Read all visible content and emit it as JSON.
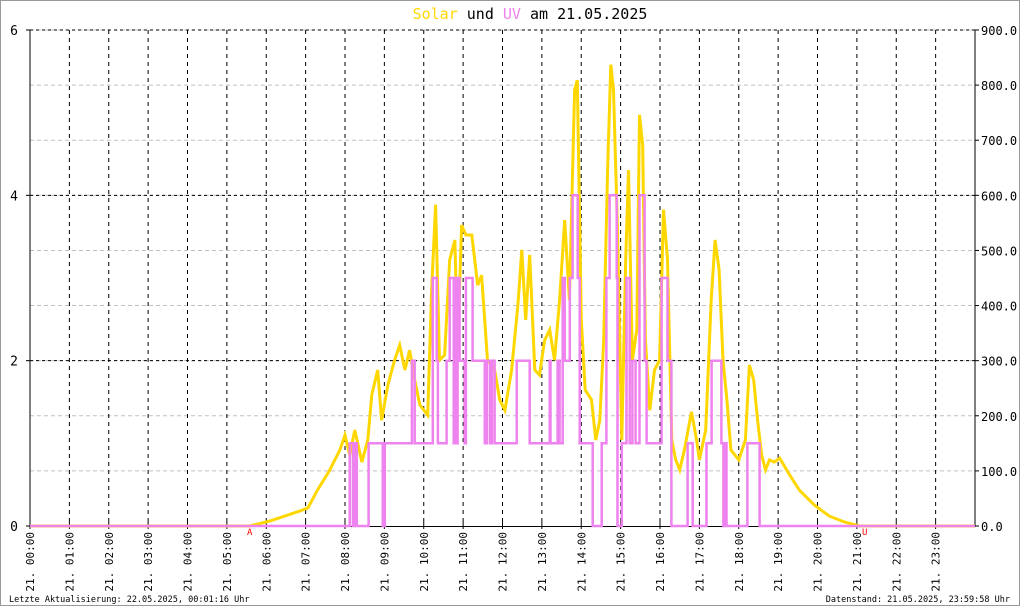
{
  "chart_data": {
    "type": "line",
    "title_parts": [
      {
        "text": "Solar",
        "color": "#ffd700"
      },
      {
        "text": " und ",
        "color": "#000000"
      },
      {
        "text": "UV",
        "color": "#ee82ee"
      },
      {
        "text": " am 21.05.2025",
        "color": "#000000"
      }
    ],
    "x_range_hours": [
      0,
      24
    ],
    "x_tick_labels": [
      "21. 00:00",
      "21. 01:00",
      "21. 02:00",
      "21. 03:00",
      "21. 04:00",
      "21. 05:00",
      "21. 06:00",
      "21. 07:00",
      "21. 08:00",
      "21. 09:00",
      "21. 10:00",
      "21. 11:00",
      "21. 12:00",
      "21. 13:00",
      "21. 14:00",
      "21. 15:00",
      "21. 16:00",
      "21. 17:00",
      "21. 18:00",
      "21. 19:00",
      "21. 20:00",
      "21. 21:00",
      "21. 22:00",
      "21. 23:00"
    ],
    "left_axis": {
      "label": "UV",
      "ylim": [
        0,
        6
      ],
      "ticks": [
        "0",
        "2",
        "4",
        "6"
      ],
      "tick_values": [
        0,
        2,
        4,
        6
      ]
    },
    "right_axis": {
      "label": "Solar",
      "ylim": [
        0,
        900
      ],
      "ticks": [
        "0.0",
        "100.0",
        "200.0",
        "300.0",
        "400.0",
        "500.0",
        "600.0",
        "700.0",
        "800.0",
        "900.0"
      ],
      "tick_values": [
        0,
        100,
        200,
        300,
        400,
        500,
        600,
        700,
        800,
        900
      ]
    },
    "grid": true,
    "markers": [
      {
        "label": "A",
        "hour": 5.58,
        "color": "#ff0000"
      },
      {
        "label": "U",
        "hour": 21.2,
        "color": "#ff0000"
      }
    ],
    "series": [
      {
        "name": "Solar",
        "axis": "right",
        "color": "#ffd700",
        "points": [
          [
            0,
            0
          ],
          [
            5.58,
            0
          ],
          [
            6.09,
            9
          ],
          [
            6.85,
            27
          ],
          [
            7.06,
            33
          ],
          [
            7.3,
            65
          ],
          [
            7.6,
            100
          ],
          [
            7.87,
            138
          ],
          [
            8.0,
            165
          ],
          [
            8.12,
            129
          ],
          [
            8.25,
            174
          ],
          [
            8.43,
            116
          ],
          [
            8.58,
            156
          ],
          [
            8.68,
            238
          ],
          [
            8.83,
            283
          ],
          [
            8.93,
            192
          ],
          [
            9.09,
            256
          ],
          [
            9.26,
            301
          ],
          [
            9.39,
            328
          ],
          [
            9.52,
            283
          ],
          [
            9.64,
            319
          ],
          [
            9.77,
            265
          ],
          [
            9.9,
            220
          ],
          [
            10.1,
            201
          ],
          [
            10.2,
            428
          ],
          [
            10.3,
            583
          ],
          [
            10.4,
            301
          ],
          [
            10.53,
            310
          ],
          [
            10.66,
            483
          ],
          [
            10.79,
            519
          ],
          [
            10.86,
            319
          ],
          [
            10.96,
            546
          ],
          [
            11.07,
            528
          ],
          [
            11.22,
            528
          ],
          [
            11.37,
            437
          ],
          [
            11.47,
            455
          ],
          [
            11.62,
            301
          ],
          [
            11.8,
            283
          ],
          [
            11.93,
            229
          ],
          [
            12.06,
            210
          ],
          [
            12.23,
            283
          ],
          [
            12.39,
            401
          ],
          [
            12.49,
            501
          ],
          [
            12.59,
            374
          ],
          [
            12.69,
            492
          ],
          [
            12.82,
            283
          ],
          [
            12.94,
            274
          ],
          [
            13.07,
            337
          ],
          [
            13.2,
            356
          ],
          [
            13.32,
            301
          ],
          [
            13.45,
            410
          ],
          [
            13.58,
            555
          ],
          [
            13.7,
            410
          ],
          [
            13.83,
            791
          ],
          [
            13.9,
            809
          ],
          [
            14.0,
            374
          ],
          [
            14.1,
            247
          ],
          [
            14.26,
            229
          ],
          [
            14.37,
            156
          ],
          [
            14.47,
            192
          ],
          [
            14.57,
            337
          ],
          [
            14.67,
            646
          ],
          [
            14.75,
            837
          ],
          [
            14.82,
            791
          ],
          [
            14.92,
            537
          ],
          [
            15.03,
            156
          ],
          [
            15.13,
            483
          ],
          [
            15.2,
            646
          ],
          [
            15.3,
            301
          ],
          [
            15.41,
            356
          ],
          [
            15.48,
            746
          ],
          [
            15.56,
            691
          ],
          [
            15.63,
            337
          ],
          [
            15.74,
            210
          ],
          [
            15.86,
            283
          ],
          [
            15.99,
            301
          ],
          [
            16.09,
            574
          ],
          [
            16.19,
            483
          ],
          [
            16.3,
            156
          ],
          [
            16.4,
            120
          ],
          [
            16.5,
            102
          ],
          [
            16.62,
            138
          ],
          [
            16.8,
            207
          ],
          [
            16.93,
            156
          ],
          [
            17.0,
            120
          ],
          [
            17.16,
            174
          ],
          [
            17.3,
            410
          ],
          [
            17.4,
            519
          ],
          [
            17.5,
            465
          ],
          [
            17.6,
            301
          ],
          [
            17.7,
            229
          ],
          [
            17.8,
            138
          ],
          [
            18.0,
            120
          ],
          [
            18.17,
            156
          ],
          [
            18.27,
            292
          ],
          [
            18.38,
            265
          ],
          [
            18.48,
            192
          ],
          [
            18.58,
            129
          ],
          [
            18.68,
            102
          ],
          [
            18.78,
            120
          ],
          [
            18.9,
            116
          ],
          [
            19.04,
            123
          ],
          [
            19.29,
            93
          ],
          [
            19.54,
            65
          ],
          [
            19.92,
            38
          ],
          [
            20.3,
            18
          ],
          [
            20.69,
            7
          ],
          [
            21.07,
            0
          ],
          [
            24,
            0
          ]
        ]
      },
      {
        "name": "UV",
        "axis": "left",
        "color": "#ee82ee",
        "step": true,
        "points": [
          [
            0,
            0
          ],
          [
            8.12,
            1
          ],
          [
            8.2,
            0
          ],
          [
            8.25,
            1
          ],
          [
            8.3,
            0
          ],
          [
            8.6,
            1
          ],
          [
            8.96,
            0
          ],
          [
            9.01,
            1
          ],
          [
            9.7,
            2
          ],
          [
            9.77,
            1
          ],
          [
            10.23,
            3
          ],
          [
            10.33,
            2
          ],
          [
            10.36,
            1
          ],
          [
            10.58,
            2
          ],
          [
            10.66,
            3
          ],
          [
            10.76,
            1
          ],
          [
            10.79,
            3
          ],
          [
            10.84,
            1
          ],
          [
            10.86,
            3
          ],
          [
            10.91,
            2
          ],
          [
            11.04,
            1
          ],
          [
            11.07,
            3
          ],
          [
            11.24,
            2
          ],
          [
            11.55,
            1
          ],
          [
            11.6,
            2
          ],
          [
            11.68,
            1
          ],
          [
            11.73,
            2
          ],
          [
            11.8,
            1
          ],
          [
            12.36,
            2
          ],
          [
            12.69,
            1
          ],
          [
            13.2,
            2
          ],
          [
            13.22,
            1
          ],
          [
            13.4,
            2
          ],
          [
            13.45,
            1
          ],
          [
            13.53,
            3
          ],
          [
            13.58,
            2
          ],
          [
            13.71,
            3
          ],
          [
            13.78,
            4
          ],
          [
            13.91,
            3
          ],
          [
            13.96,
            1
          ],
          [
            14.29,
            0
          ],
          [
            14.52,
            1
          ],
          [
            14.64,
            3
          ],
          [
            14.72,
            4
          ],
          [
            14.9,
            3
          ],
          [
            14.92,
            0
          ],
          [
            15.03,
            1
          ],
          [
            15.15,
            3
          ],
          [
            15.23,
            1
          ],
          [
            15.3,
            2
          ],
          [
            15.38,
            1
          ],
          [
            15.48,
            4
          ],
          [
            15.61,
            2
          ],
          [
            15.66,
            1
          ],
          [
            16.04,
            3
          ],
          [
            16.19,
            2
          ],
          [
            16.29,
            0
          ],
          [
            16.7,
            1
          ],
          [
            16.83,
            0
          ],
          [
            17.18,
            1
          ],
          [
            17.31,
            2
          ],
          [
            17.56,
            1
          ],
          [
            17.61,
            0
          ],
          [
            17.66,
            1
          ],
          [
            17.69,
            0
          ],
          [
            18.22,
            1
          ],
          [
            18.53,
            0
          ],
          [
            24,
            0
          ]
        ]
      }
    ]
  },
  "footer": {
    "last_update": "Letzte Aktualisierung: 22.05.2025, 00:01:16 Uhr",
    "data_state": "Datenstand: 21.05.2025, 23:59:58 Uhr"
  }
}
